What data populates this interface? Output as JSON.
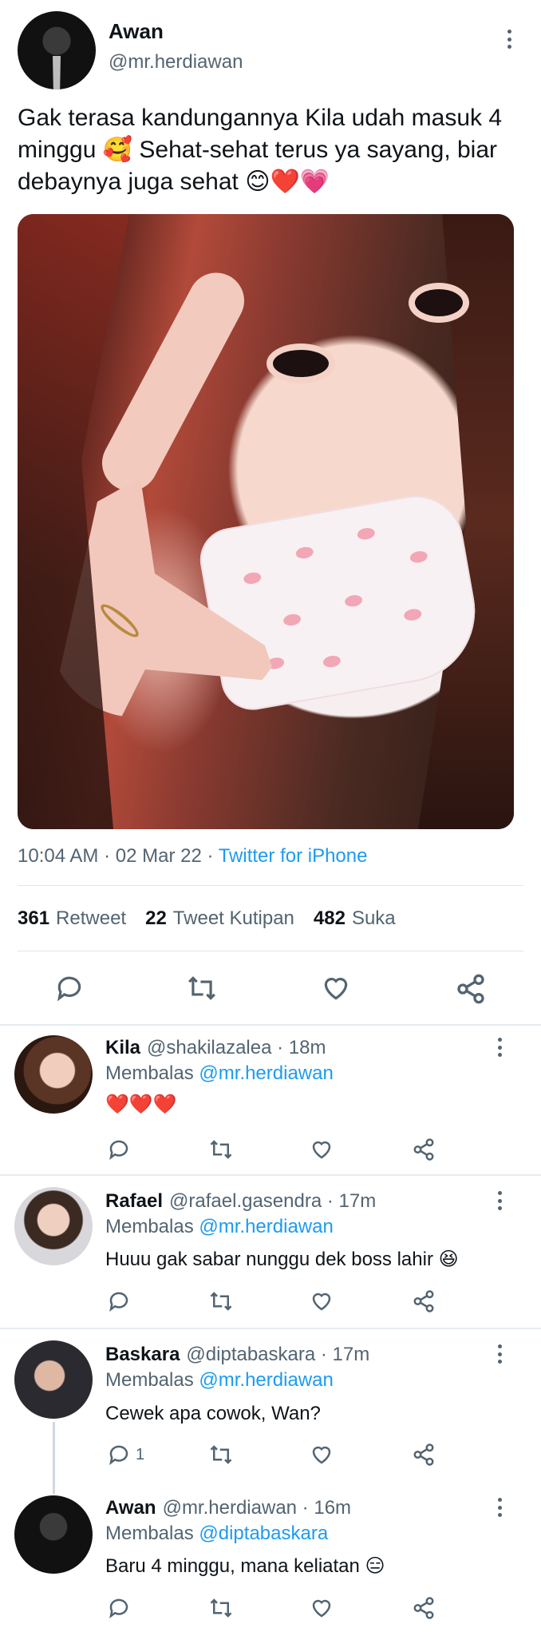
{
  "main": {
    "name": "Awan",
    "handle": "@mr.herdiawan",
    "text": "Gak terasa kandungannya Kila udah masuk 4 minggu 🥰 Sehat-sehat terus ya sayang, biar debaynya juga sehat 😊❤️💗",
    "time": "10:04 AM",
    "date": "02 Mar 22",
    "source": "Twitter for iPhone",
    "retweets": "361",
    "retweets_label": "Retweet",
    "quotes": "22",
    "quotes_label": "Tweet Kutipan",
    "likes": "482",
    "likes_label": "Suka"
  },
  "replies": [
    {
      "name": "Kila",
      "handle": "@shakilazalea",
      "time": "18m",
      "replying_label": "Membalas",
      "replying_to": "@mr.herdiawan",
      "text": "❤️❤️❤️",
      "reply_count": ""
    },
    {
      "name": "Rafael",
      "handle": "@rafael.gasendra",
      "time": "17m",
      "replying_label": "Membalas",
      "replying_to": "@mr.herdiawan",
      "text": "Huuu gak sabar nunggu dek boss lahir 😆",
      "reply_count": ""
    },
    {
      "name": "Baskara",
      "handle": "@diptabaskara",
      "time": "17m",
      "replying_label": "Membalas",
      "replying_to": "@mr.herdiawan",
      "text": "Cewek apa cowok, Wan?",
      "reply_count": "1"
    },
    {
      "name": "Awan",
      "handle": "@mr.herdiawan",
      "time": "16m",
      "replying_label": "Membalas",
      "replying_to": "@diptabaskara",
      "text": "Baru 4 minggu, mana keliatan 😑",
      "reply_count": ""
    }
  ],
  "icons": {
    "reply": "reply-icon",
    "retweet": "retweet-icon",
    "like": "heart-icon",
    "share": "share-icon",
    "more": "more-icon"
  },
  "colors": {
    "link": "#1d9bf0",
    "secondary": "#536471",
    "text": "#0f1419"
  }
}
